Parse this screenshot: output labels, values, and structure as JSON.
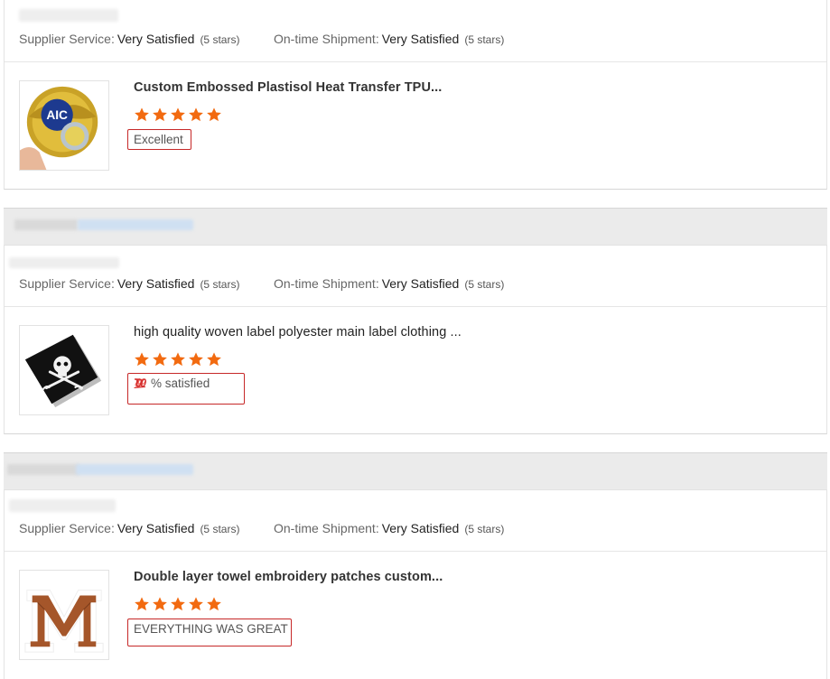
{
  "labels": {
    "supplier_service": "Supplier Service:",
    "ontime_shipment": "On-time Shipment:"
  },
  "colors": {
    "star": "#f26a10",
    "comment_border": "#c62828",
    "gap_bg": "#ebebeb"
  },
  "reviews": [
    {
      "supplier_service": {
        "value": "Very Satisfied",
        "note": "(5 stars)"
      },
      "ontime_shipment": {
        "value": "Very Satisfied",
        "note": "(5 stars)"
      },
      "product": {
        "title": "Custom Embossed Plastisol Heat Transfer TPU...",
        "image_icon": "challenge-coin-icon",
        "rating": 5,
        "comment": "Excellent"
      }
    },
    {
      "supplier_service": {
        "value": "Very Satisfied",
        "note": "(5 stars)"
      },
      "ontime_shipment": {
        "value": "Very Satisfied",
        "note": "(5 stars)"
      },
      "product": {
        "title": "high quality woven label polyester main label clothing ...",
        "image_icon": "skull-label-icon",
        "rating": 5,
        "comment_prefix_icon": "hundred-points-icon",
        "comment": "% satisfied"
      }
    },
    {
      "supplier_service": {
        "value": "Very Satisfied",
        "note": "(5 stars)"
      },
      "ontime_shipment": {
        "value": "Very Satisfied",
        "note": "(5 stars)"
      },
      "product": {
        "title": "Double layer towel embroidery patches custom...",
        "image_icon": "letter-m-patch-icon",
        "rating": 5,
        "comment": "EVERYTHING WAS GREAT"
      }
    }
  ]
}
